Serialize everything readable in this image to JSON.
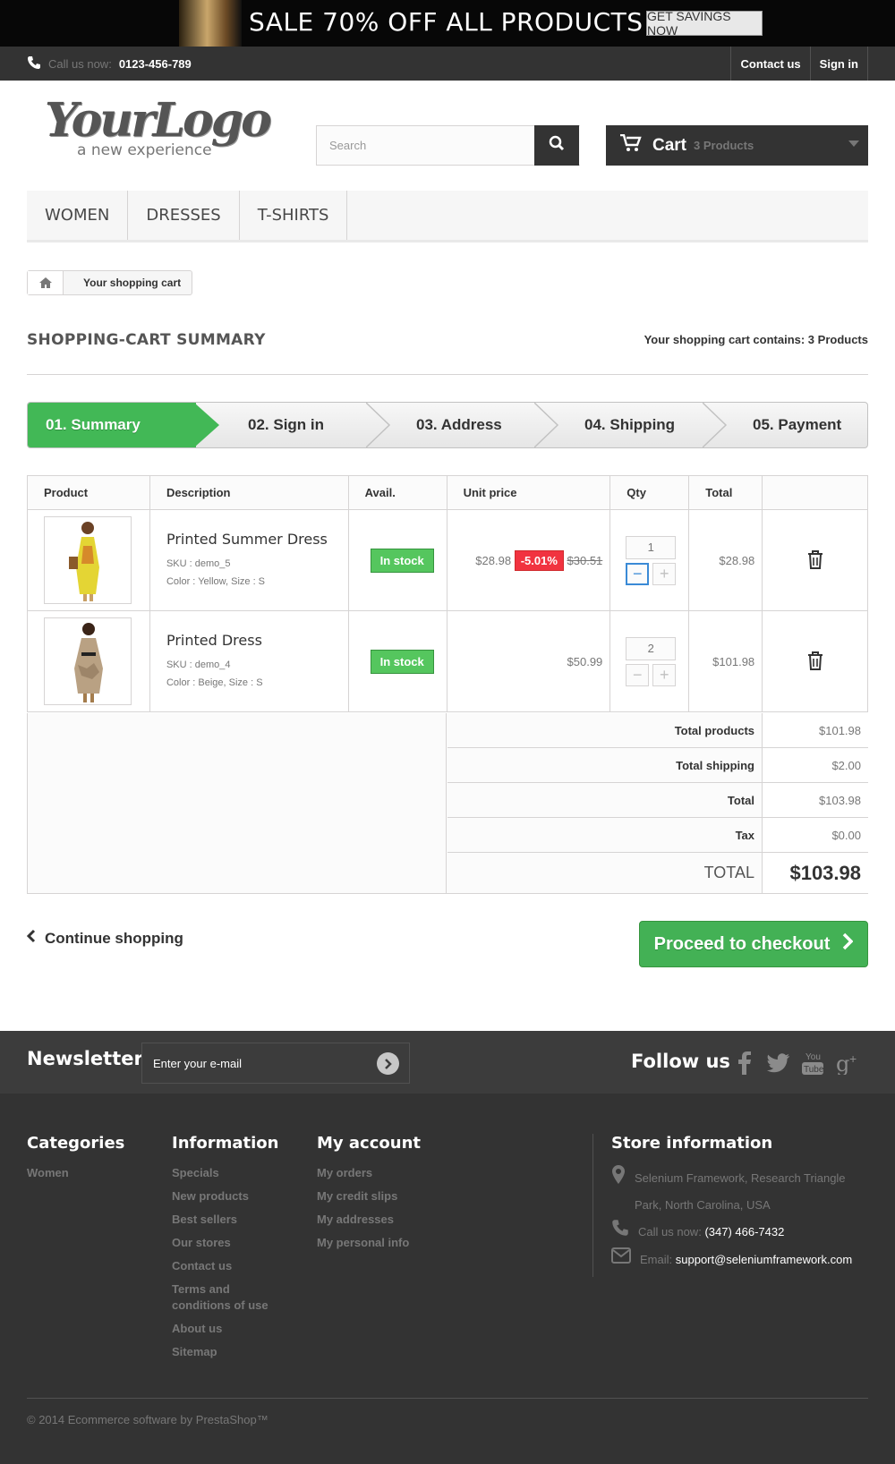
{
  "banner": {
    "sale_text": "SALE 70% OFF ALL PRODUCTS",
    "savings_button": "GET SAVINGS NOW"
  },
  "topbar": {
    "call_label": "Call us now:",
    "call_number": "0123-456-789",
    "contact_link": "Contact us",
    "signin_link": "Sign in"
  },
  "logo": {
    "line1": "YourLogo",
    "line2": "a new experience"
  },
  "search": {
    "placeholder": "Search"
  },
  "cart": {
    "label": "Cart",
    "quantity": "3 Products"
  },
  "menu": [
    "WOMEN",
    "DRESSES",
    "T-SHIRTS"
  ],
  "breadcrumb": {
    "current": "Your shopping cart"
  },
  "page": {
    "title": "SHOPPING-CART SUMMARY",
    "contains": "Your shopping cart contains: 3 Products"
  },
  "steps": [
    "01. Summary",
    "02. Sign in",
    "03. Address",
    "04. Shipping",
    "05. Payment"
  ],
  "table": {
    "headers": [
      "Product",
      "Description",
      "Avail.",
      "Unit price",
      "Qty",
      "Total",
      ""
    ],
    "rows": [
      {
        "name": "Printed Summer Dress",
        "sku": "SKU : demo_5",
        "attrs": "Color : Yellow, Size : S",
        "avail": "In stock",
        "price": "$28.98",
        "discount": "-5.01%",
        "old_price": "$30.51",
        "qty": "1",
        "total": "$28.98"
      },
      {
        "name": "Printed Dress",
        "sku": "SKU : demo_4",
        "attrs": "Color : Beige, Size : S",
        "avail": "In stock",
        "price": "$50.99",
        "discount": "",
        "old_price": "",
        "qty": "2",
        "total": "$101.98"
      }
    ]
  },
  "totals": {
    "products_label": "Total products",
    "products": "$101.98",
    "shipping_label": "Total shipping",
    "shipping": "$2.00",
    "total_label": "Total",
    "total": "$103.98",
    "tax_label": "Tax",
    "tax": "$0.00",
    "grand_label": "TOTAL",
    "grand": "$103.98"
  },
  "actions": {
    "continue": "Continue shopping",
    "proceed": "Proceed to checkout"
  },
  "newsletter": {
    "title": "Newsletter",
    "placeholder": "Enter your e-mail",
    "follow": "Follow us"
  },
  "footer": {
    "categories": {
      "title": "Categories",
      "items": [
        "Women"
      ]
    },
    "information": {
      "title": "Information",
      "items": [
        "Specials",
        "New products",
        "Best sellers",
        "Our stores",
        "Contact us",
        "Terms and conditions of use",
        "About us",
        "Sitemap"
      ]
    },
    "account": {
      "title": "My account",
      "items": [
        "My orders",
        "My credit slips",
        "My addresses",
        "My personal info"
      ]
    },
    "store": {
      "title": "Store information",
      "address": "Selenium Framework, Research Triangle Park, North Carolina, USA",
      "call_label": "Call us now:",
      "phone": "(347) 466-7432",
      "email_label": "Email:",
      "email": "support@seleniumframework.com"
    },
    "copyright": "© 2014 Ecommerce software by PrestaShop™"
  },
  "colors": {
    "accent_green": "#42b856",
    "dark": "#333333",
    "discount_red": "#f13340"
  }
}
